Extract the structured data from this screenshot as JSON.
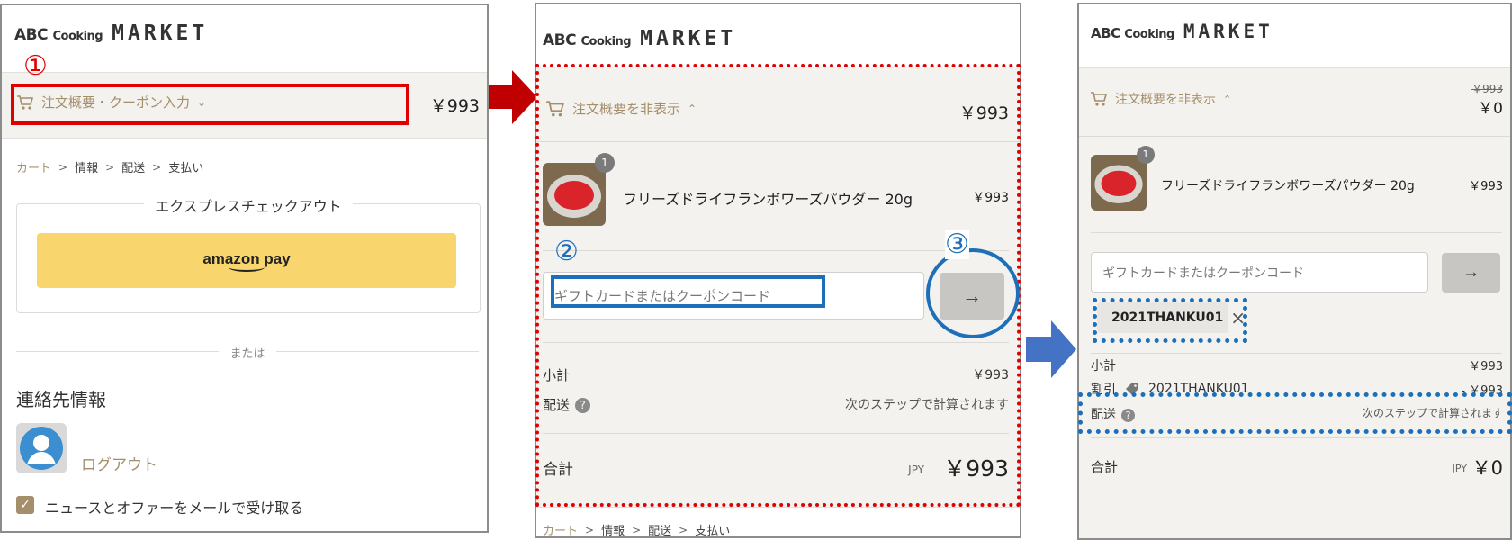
{
  "brand": {
    "abc": "ABC",
    "cooking": "Cooking",
    "market": "MARKET"
  },
  "step1": {
    "annotation": "①",
    "summary_toggle": "注文概要・クーポン入力",
    "header_price": "￥993",
    "breadcrumb": [
      "カート",
      "情報",
      "配送",
      "支払い"
    ],
    "express_title": "エクスプレスチェックアウト",
    "amazon_pay": "amazon pay",
    "or": "または",
    "contact_heading": "連絡先情報",
    "logout": "ログアウト",
    "newsletter": "ニュースとオファーをメールで受け取る",
    "newsletter_checked": true
  },
  "step2": {
    "annotation_input": "②",
    "annotation_button": "③",
    "summary_toggle": "注文概要を非表示",
    "header_price": "￥993",
    "product": {
      "name": "フリーズドライフランボワーズパウダー 20g",
      "price": "￥993",
      "qty": "1"
    },
    "coupon_placeholder": "ギフトカードまたはクーポンコード",
    "subtotal_label": "小計",
    "subtotal": "￥993",
    "shipping_label": "配送",
    "shipping_note": "次のステップで計算されます",
    "total_label": "合計",
    "currency": "JPY",
    "total": "￥993",
    "breadcrumb": [
      "カート",
      "情報",
      "配送",
      "支払い"
    ]
  },
  "step3": {
    "summary_toggle": "注文概要を非表示",
    "old_price": "￥993",
    "header_price": "￥0",
    "product": {
      "name": "フリーズドライフランボワーズパウダー 20g",
      "price": "￥993",
      "qty": "1"
    },
    "coupon_placeholder": "ギフトカードまたはクーポンコード",
    "applied_code": "2021THANKU01",
    "subtotal_label": "小計",
    "subtotal": "￥993",
    "discount_label": "割引",
    "discount_code": "2021THANKU01",
    "discount_value": "- ￥993",
    "shipping_label": "配送",
    "shipping_note": "次のステップで計算されます",
    "total_label": "合計",
    "currency": "JPY",
    "total": "￥0"
  },
  "colors": {
    "accent": "#a58e6a",
    "red_annotation": "#e00000",
    "blue_annotation": "#1c6fb8",
    "arrow_red": "#c00000",
    "arrow_blue": "#4472c4"
  }
}
